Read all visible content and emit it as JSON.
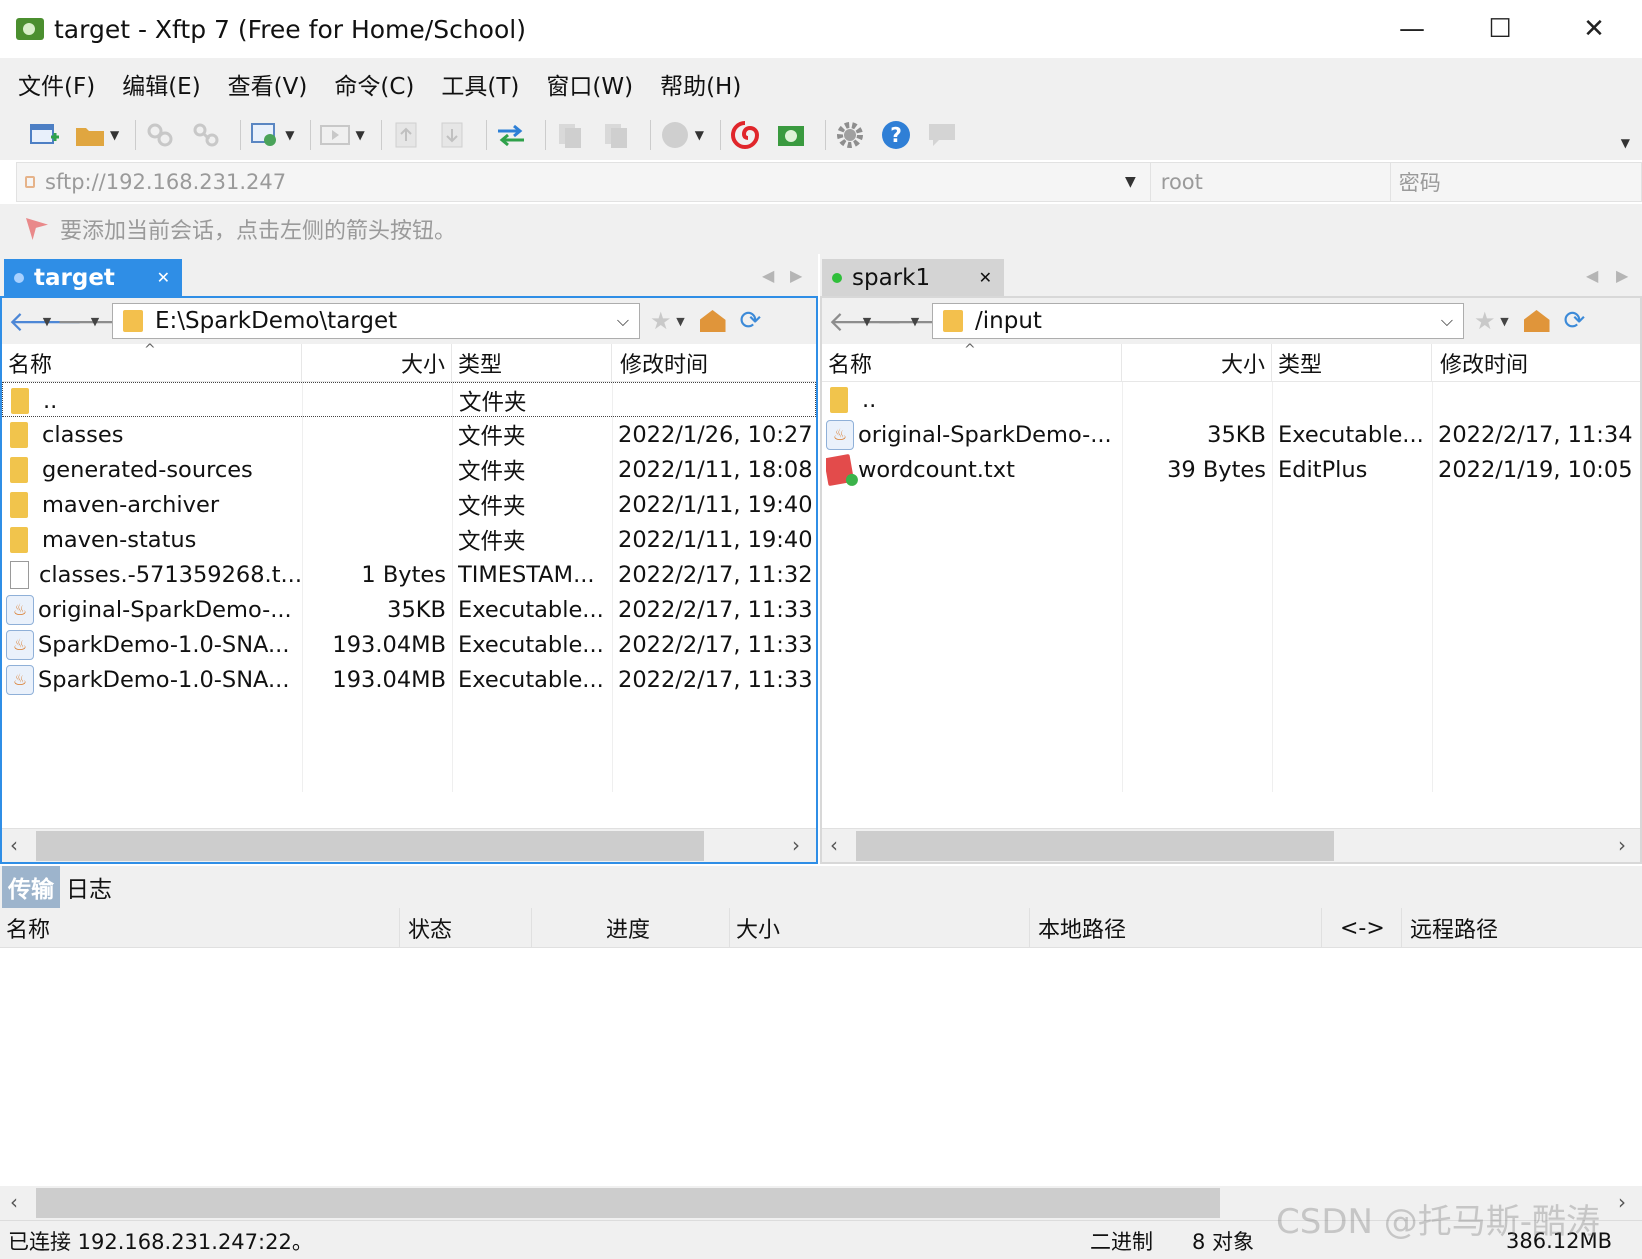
{
  "window": {
    "title": "target - Xftp 7 (Free for Home/School)",
    "minimize": "—",
    "maximize": "☐",
    "close": "✕"
  },
  "menu": [
    "文件(F)",
    "编辑(E)",
    "查看(V)",
    "命令(C)",
    "工具(T)",
    "窗口(W)",
    "帮助(H)"
  ],
  "toolbar": {
    "icons": [
      "new-session-icon",
      "open-folder-icon",
      "sync-icon",
      "link-icon",
      "session-manager-icon",
      "play-icon",
      "upload-icon",
      "download-icon",
      "transfer-icon",
      "copy-icon",
      "paste-icon",
      "stop-icon",
      "xshell-icon",
      "xftp-icon",
      "settings-icon",
      "help-icon",
      "chat-icon"
    ]
  },
  "address": {
    "host_placeholder": "sftp://192.168.231.247",
    "user_placeholder": "root",
    "password_placeholder": "密码"
  },
  "hint": "要添加当前会话，点击左侧的箭头按钮。",
  "left_pane": {
    "tab_label": "target",
    "tab_status_color": "#4fa3f7",
    "path": "E:\\SparkDemo\\target",
    "columns": [
      "名称",
      "大小",
      "类型",
      "修改时间"
    ],
    "rows": [
      {
        "icon": "folder-icon",
        "name": "..",
        "size": "",
        "type": "文件夹",
        "modified": ""
      },
      {
        "icon": "folder-icon",
        "name": "classes",
        "size": "",
        "type": "文件夹",
        "modified": "2022/1/26, 10:27"
      },
      {
        "icon": "folder-icon",
        "name": "generated-sources",
        "size": "",
        "type": "文件夹",
        "modified": "2022/1/11, 18:08"
      },
      {
        "icon": "folder-icon",
        "name": "maven-archiver",
        "size": "",
        "type": "文件夹",
        "modified": "2022/1/11, 19:40"
      },
      {
        "icon": "folder-icon",
        "name": "maven-status",
        "size": "",
        "type": "文件夹",
        "modified": "2022/1/11, 19:40"
      },
      {
        "icon": "file-icon",
        "name": "classes.-571359268.t...",
        "size": "1 Bytes",
        "type": "TIMESTAM...",
        "modified": "2022/2/17, 11:32"
      },
      {
        "icon": "jar-icon",
        "name": "original-SparkDemo-...",
        "size": "35KB",
        "type": "Executable...",
        "modified": "2022/2/17, 11:33"
      },
      {
        "icon": "jar-icon",
        "name": "SparkDemo-1.0-SNA...",
        "size": "193.04MB",
        "type": "Executable...",
        "modified": "2022/2/17, 11:33"
      },
      {
        "icon": "jar-icon",
        "name": "SparkDemo-1.0-SNA...",
        "size": "193.04MB",
        "type": "Executable...",
        "modified": "2022/2/17, 11:33"
      }
    ]
  },
  "right_pane": {
    "tab_label": "spark1",
    "tab_status_color": "#2fbf3a",
    "path": "/input",
    "columns": [
      "名称",
      "大小",
      "类型",
      "修改时间"
    ],
    "rows": [
      {
        "icon": "folder-icon",
        "name": "..",
        "size": "",
        "type": "",
        "modified": ""
      },
      {
        "icon": "jar-icon",
        "name": "original-SparkDemo-...",
        "size": "35KB",
        "type": "Executable...",
        "modified": "2022/2/17, 11:34"
      },
      {
        "icon": "text-file-icon",
        "name": "wordcount.txt",
        "size": "39 Bytes",
        "type": "EditPlus",
        "modified": "2022/1/19, 10:05"
      }
    ]
  },
  "transfer": {
    "tabs": [
      "传输",
      "日志"
    ],
    "columns": [
      "名称",
      "状态",
      "进度",
      "大小",
      "本地路径",
      "<->",
      "远程路径"
    ]
  },
  "status": {
    "connection": "已连接 192.168.231.247:22。",
    "mode": "二进制",
    "objects": "8 对象",
    "size": "386.12MB"
  },
  "watermark": "CSDN @托马斯-酷涛"
}
